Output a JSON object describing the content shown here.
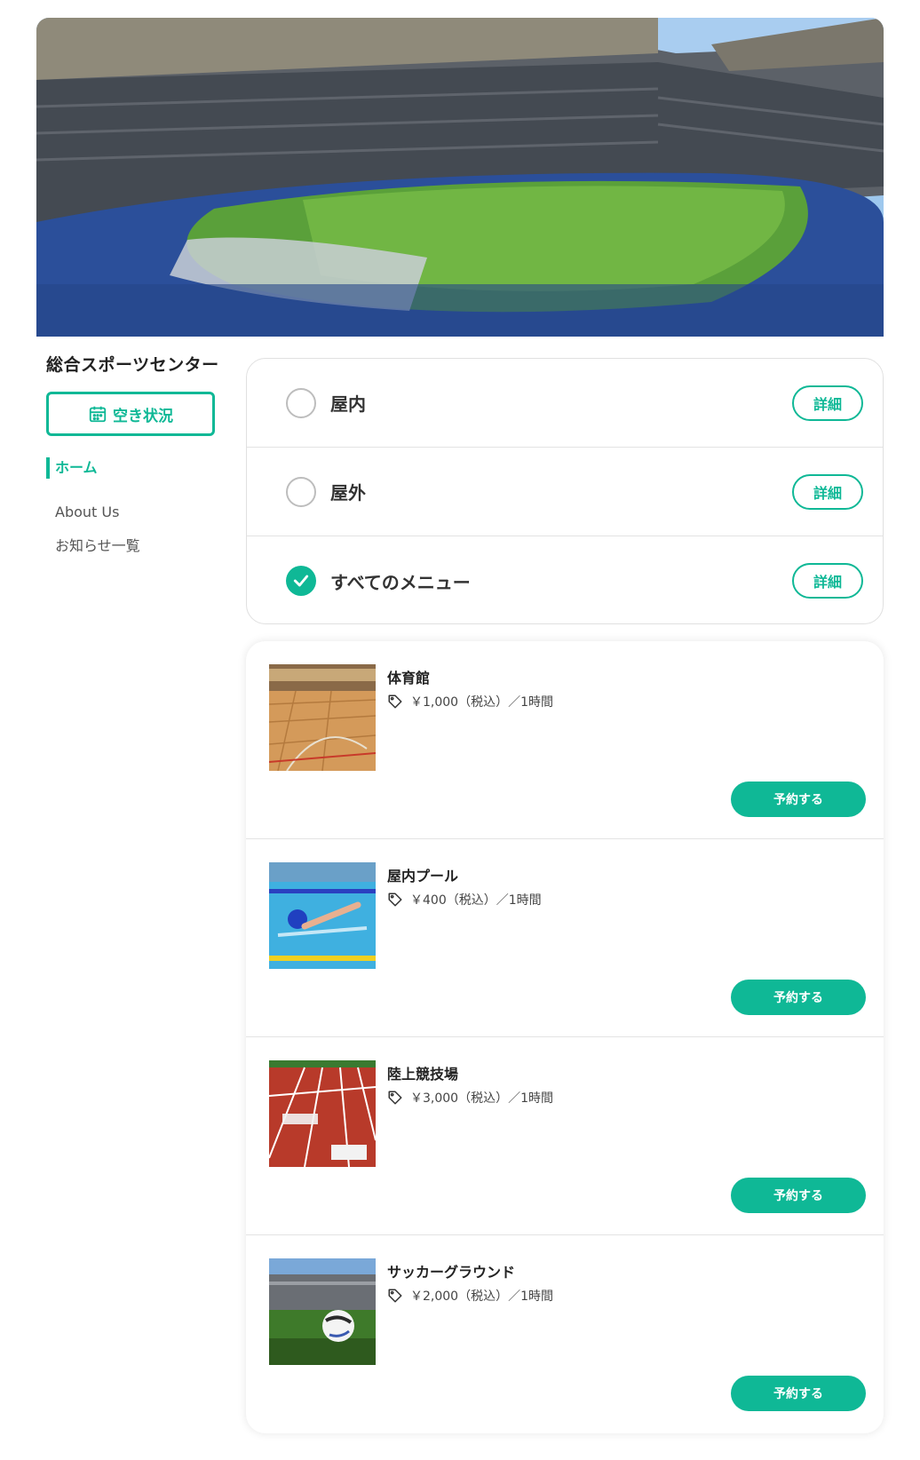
{
  "site": {
    "title": "総合スポーツセンター"
  },
  "availability_button": {
    "label": "空き状況",
    "icon": "calendar-icon"
  },
  "nav": [
    {
      "label": "ホーム",
      "active": true
    },
    {
      "label": "About Us",
      "active": false
    },
    {
      "label": "お知らせ一覧",
      "active": false
    }
  ],
  "categories": [
    {
      "label": "屋内",
      "checked": false,
      "detail_label": "詳細"
    },
    {
      "label": "屋外",
      "checked": false,
      "detail_label": "詳細"
    },
    {
      "label": "すべてのメニュー",
      "checked": true,
      "detail_label": "詳細"
    }
  ],
  "facilities": [
    {
      "name": "体育館",
      "price": "￥1,000（税込）／1時間",
      "image": "gymnasium-photo",
      "reserve_label": "予約する"
    },
    {
      "name": "屋内プール",
      "price": "￥400（税込）／1時間",
      "image": "swimming-pool-photo",
      "reserve_label": "予約する"
    },
    {
      "name": "陸上競技場",
      "price": "￥3,000（税込）／1時間",
      "image": "running-track-photo",
      "reserve_label": "予約する"
    },
    {
      "name": "サッカーグラウンド",
      "price": "￥2,000（税込）／1時間",
      "image": "soccer-ball-photo",
      "reserve_label": "予約する"
    }
  ],
  "colors": {
    "accent": "#0fb896",
    "text": "#333333",
    "border": "#e3e3e3"
  }
}
